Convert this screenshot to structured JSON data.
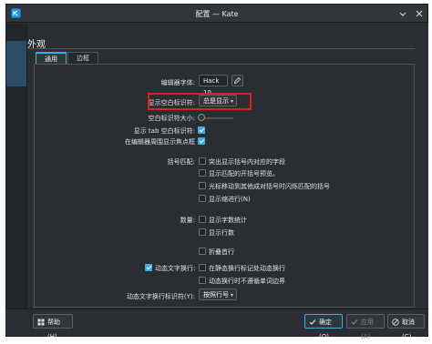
{
  "window": {
    "title": "配置 — Kate"
  },
  "section": {
    "title": "外观"
  },
  "tabs": [
    {
      "label": "通用"
    },
    {
      "label": "边框"
    }
  ],
  "rows": {
    "editor_font_label": "编辑器字体:",
    "editor_font_value": "Hack 10",
    "show_ws_label": "显示空白标识符:",
    "show_ws_value": "总是显示",
    "ws_size_label": "空白标识符大小:",
    "show_tab_label": "显示 tab 空白标识符:",
    "show_focus_label": "在编辑器周围显示焦点框",
    "bracket_label": "括号匹配:",
    "bracket_options": [
      "突出显示括号内对应的字段",
      "显示匹配的开括号预览。",
      "光标移动到其他成对括号时闪烁匹配的括号",
      "显示缩进行(N)"
    ],
    "counts_label": "数量:",
    "counts_options": [
      "显示字数统计",
      "显示行数"
    ],
    "fold_label": "折叠首行",
    "dynwrap_label": "动态文字换行:",
    "dynwrap_options": [
      "在静态换行标记处动态换行",
      "动态换行时不遵循单词边界"
    ],
    "dynwrap_indicator_label": "动态文字换行标识符(Y):",
    "dynwrap_indicator_value": "按照行号"
  },
  "footer": {
    "help": "帮助(H)",
    "ok": "确定(O)",
    "apply": "应用(A)",
    "cancel": "取消(C)"
  },
  "colors": {
    "accent": "#3daee9",
    "highlight_box": "#e0201b",
    "background": "#2a2e32"
  }
}
